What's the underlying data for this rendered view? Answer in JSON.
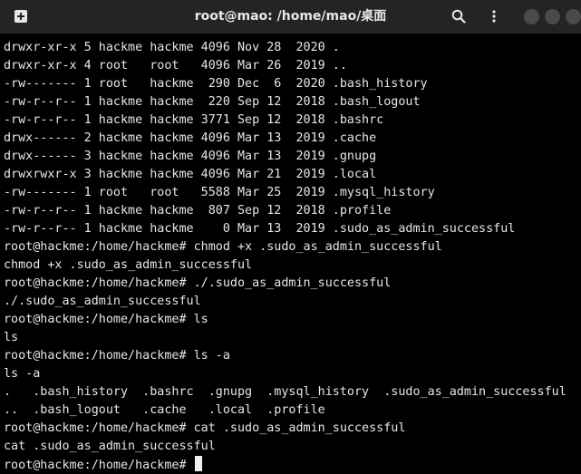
{
  "titlebar": {
    "title": "root@mao: /home/mao/桌面",
    "icons": [
      "new-tab-icon",
      "search-icon",
      "hamburger-menu-icon"
    ]
  },
  "terminal": {
    "lines": [
      "drwxr-xr-x 5 hackme hackme 4096 Nov 28  2020 .",
      "drwxr-xr-x 4 root   root   4096 Mar 26  2019 ..",
      "-rw------- 1 root   hackme  290 Dec  6  2020 .bash_history",
      "-rw-r--r-- 1 hackme hackme  220 Sep 12  2018 .bash_logout",
      "-rw-r--r-- 1 hackme hackme 3771 Sep 12  2018 .bashrc",
      "drwx------ 2 hackme hackme 4096 Mar 13  2019 .cache",
      "drwx------ 3 hackme hackme 4096 Mar 13  2019 .gnupg",
      "drwxrwxr-x 3 hackme hackme 4096 Mar 21  2019 .local",
      "-rw------- 1 root   root   5588 Mar 25  2019 .mysql_history",
      "-rw-r--r-- 1 hackme hackme  807 Sep 12  2018 .profile",
      "-rw-r--r-- 1 hackme hackme    0 Mar 13  2019 .sudo_as_admin_successful",
      "root@hackme:/home/hackme# chmod +x .sudo_as_admin_successful",
      "chmod +x .sudo_as_admin_successful",
      "root@hackme:/home/hackme# ./.sudo_as_admin_successful",
      "./.sudo_as_admin_successful",
      "root@hackme:/home/hackme# ls",
      "ls",
      "root@hackme:/home/hackme# ls -a",
      "ls -a",
      ".   .bash_history  .bashrc  .gnupg  .mysql_history  .sudo_as_admin_successful",
      "..  .bash_logout   .cache   .local  .profile",
      "root@hackme:/home/hackme# cat .sudo_as_admin_successful",
      "cat .sudo_as_admin_successful"
    ],
    "prompt": "root@hackme:/home/hackme# "
  }
}
